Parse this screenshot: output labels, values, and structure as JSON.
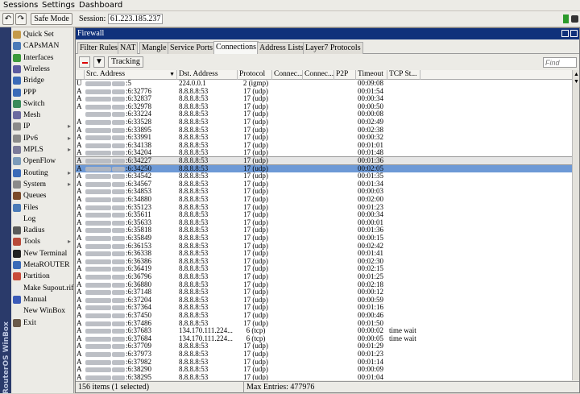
{
  "menu": {
    "sessions": "Sessions",
    "settings": "Settings",
    "dashboard": "Dashboard"
  },
  "toolbar": {
    "safe_mode": "Safe Mode",
    "session_label": "Session:",
    "session_value": "61.223.185.237"
  },
  "vertical_brand": "RouterOS WinBox",
  "sidebar": {
    "items": [
      {
        "label": "Quick Set",
        "icon": "quick-set-icon",
        "color": "#c49a4a",
        "submenu": false
      },
      {
        "label": "CAPsMAN",
        "icon": "capsman-icon",
        "color": "#4a7ab8",
        "submenu": false
      },
      {
        "label": "Interfaces",
        "icon": "interfaces-icon",
        "color": "#3c9a3c",
        "submenu": false
      },
      {
        "label": "Wireless",
        "icon": "wireless-icon",
        "color": "#5a5aa0",
        "submenu": false
      },
      {
        "label": "Bridge",
        "icon": "bridge-icon",
        "color": "#3a6ab8",
        "submenu": false
      },
      {
        "label": "PPP",
        "icon": "ppp-icon",
        "color": "#3a6ab8",
        "submenu": false
      },
      {
        "label": "Switch",
        "icon": "switch-icon",
        "color": "#3a8a5a",
        "submenu": false
      },
      {
        "label": "Mesh",
        "icon": "mesh-icon",
        "color": "#6a6aa0",
        "submenu": false
      },
      {
        "label": "IP",
        "icon": "ip-icon",
        "color": "#8a8a8a",
        "submenu": true
      },
      {
        "label": "IPv6",
        "icon": "ipv6-icon",
        "color": "#8a8a8a",
        "submenu": true
      },
      {
        "label": "MPLS",
        "icon": "mpls-icon",
        "color": "#7a7a9a",
        "submenu": true
      },
      {
        "label": "OpenFlow",
        "icon": "openflow-icon",
        "color": "#7a9aba",
        "submenu": false
      },
      {
        "label": "Routing",
        "icon": "routing-icon",
        "color": "#3a6ab8",
        "submenu": true
      },
      {
        "label": "System",
        "icon": "system-icon",
        "color": "#8a8a8a",
        "submenu": true
      },
      {
        "label": "Queues",
        "icon": "queues-icon",
        "color": "#7a4a2a",
        "submenu": false
      },
      {
        "label": "Files",
        "icon": "files-icon",
        "color": "#4a7ab8",
        "submenu": false
      },
      {
        "label": "Log",
        "icon": "log-icon",
        "color": "#eaeaea",
        "submenu": false
      },
      {
        "label": "Radius",
        "icon": "radius-icon",
        "color": "#5a5a5a",
        "submenu": false
      },
      {
        "label": "Tools",
        "icon": "tools-icon",
        "color": "#b84a3a",
        "submenu": true
      },
      {
        "label": "New Terminal",
        "icon": "terminal-icon",
        "color": "#222222",
        "submenu": false
      },
      {
        "label": "MetaROUTER",
        "icon": "metarouter-icon",
        "color": "#3a6ab8",
        "submenu": false
      },
      {
        "label": "Partition",
        "icon": "partition-icon",
        "color": "#c84a3a",
        "submenu": false
      },
      {
        "label": "Make Supout.rif",
        "icon": "supout-icon",
        "color": "#eaeaea",
        "submenu": false
      },
      {
        "label": "Manual",
        "icon": "manual-icon",
        "color": "#3a5ab8",
        "submenu": false
      },
      {
        "label": "New WinBox",
        "icon": "winbox-icon",
        "color": "#ecebe6",
        "submenu": false
      },
      {
        "label": "Exit",
        "icon": "exit-icon",
        "color": "#6a5a4a",
        "submenu": false
      }
    ]
  },
  "window": {
    "title": "Firewall",
    "tabs": [
      "Filter Rules",
      "NAT",
      "Mangle",
      "Service Ports",
      "Connections",
      "Address Lists",
      "Layer7 Protocols"
    ],
    "tracking_label": "Tracking",
    "find_placeholder": "Find",
    "columns": [
      "",
      "Src. Address",
      "Dst. Address",
      "Protocol",
      "Connec...",
      "Connec...",
      "P2P",
      "Timeout",
      "TCP St..."
    ],
    "rows": [
      {
        "flag": "U",
        "src": ":5",
        "dst": "224.0.0.1",
        "proto": "2 (igmp)",
        "timeout": "00:09:08",
        "tcp": ""
      },
      {
        "flag": "A",
        "src": ":6:32776",
        "dst": "8.8.8.8:53",
        "proto": "17 (udp)",
        "timeout": "00:01:54",
        "tcp": ""
      },
      {
        "flag": "A",
        "src": ":6:32837",
        "dst": "8.8.8.8:53",
        "proto": "17 (udp)",
        "timeout": "00:00:34",
        "tcp": ""
      },
      {
        "flag": "A",
        "src": ":6:32978",
        "dst": "8.8.8.8:53",
        "proto": "17 (udp)",
        "timeout": "00:00:50",
        "tcp": ""
      },
      {
        "flag": "",
        "src": ":6:33224",
        "dst": "8.8.8.8:53",
        "proto": "17 (udp)",
        "timeout": "00:00:08",
        "tcp": ""
      },
      {
        "flag": "A",
        "src": ":6:33528",
        "dst": "8.8.8.8:53",
        "proto": "17 (udp)",
        "timeout": "00:02:49",
        "tcp": ""
      },
      {
        "flag": "A",
        "src": ":6:33895",
        "dst": "8.8.8.8:53",
        "proto": "17 (udp)",
        "timeout": "00:02:38",
        "tcp": ""
      },
      {
        "flag": "A",
        "src": ":6:33991",
        "dst": "8.8.8.8:53",
        "proto": "17 (udp)",
        "timeout": "00:00:32",
        "tcp": ""
      },
      {
        "flag": "A",
        "src": ":6:34138",
        "dst": "8.8.8.8:53",
        "proto": "17 (udp)",
        "timeout": "00:01:01",
        "tcp": ""
      },
      {
        "flag": "A",
        "src": ":6:34204",
        "dst": "8.8.8.8:53",
        "proto": "17 (udp)",
        "timeout": "00:01:48",
        "tcp": ""
      },
      {
        "flag": "A",
        "src": ":6:34227",
        "dst": "8.8.8.8:53",
        "proto": "17 (udp)",
        "timeout": "00:01:36",
        "tcp": ""
      },
      {
        "flag": "A",
        "src": ":6:34250",
        "dst": "8.8.8.8:53",
        "proto": "17 (udp)",
        "timeout": "00:02:05",
        "tcp": ""
      },
      {
        "flag": "A",
        "src": ":6:34542",
        "dst": "8.8.8.8:53",
        "proto": "17 (udp)",
        "timeout": "00:01:35",
        "tcp": ""
      },
      {
        "flag": "A",
        "src": ":6:34567",
        "dst": "8.8.8.8:53",
        "proto": "17 (udp)",
        "timeout": "00:01:34",
        "tcp": ""
      },
      {
        "flag": "A",
        "src": ":6:34853",
        "dst": "8.8.8.8:53",
        "proto": "17 (udp)",
        "timeout": "00:00:03",
        "tcp": ""
      },
      {
        "flag": "A",
        "src": ":6:34880",
        "dst": "8.8.8.8:53",
        "proto": "17 (udp)",
        "timeout": "00:02:00",
        "tcp": ""
      },
      {
        "flag": "A",
        "src": ":6:35123",
        "dst": "8.8.8.8:53",
        "proto": "17 (udp)",
        "timeout": "00:01:23",
        "tcp": ""
      },
      {
        "flag": "A",
        "src": ":6:35611",
        "dst": "8.8.8.8:53",
        "proto": "17 (udp)",
        "timeout": "00:00:34",
        "tcp": ""
      },
      {
        "flag": "A",
        "src": ":6:35633",
        "dst": "8.8.8.8:53",
        "proto": "17 (udp)",
        "timeout": "00:00:01",
        "tcp": ""
      },
      {
        "flag": "A",
        "src": ":6:35818",
        "dst": "8.8.8.8:53",
        "proto": "17 (udp)",
        "timeout": "00:01:36",
        "tcp": ""
      },
      {
        "flag": "A",
        "src": ":6:35849",
        "dst": "8.8.8.8:53",
        "proto": "17 (udp)",
        "timeout": "00:00:15",
        "tcp": ""
      },
      {
        "flag": "A",
        "src": ":6:36153",
        "dst": "8.8.8.8:53",
        "proto": "17 (udp)",
        "timeout": "00:02:42",
        "tcp": ""
      },
      {
        "flag": "A",
        "src": ":6:36338",
        "dst": "8.8.8.8:53",
        "proto": "17 (udp)",
        "timeout": "00:01:41",
        "tcp": ""
      },
      {
        "flag": "A",
        "src": ":6:36386",
        "dst": "8.8.8.8:53",
        "proto": "17 (udp)",
        "timeout": "00:02:30",
        "tcp": ""
      },
      {
        "flag": "A",
        "src": ":6:36419",
        "dst": "8.8.8.8:53",
        "proto": "17 (udp)",
        "timeout": "00:02:15",
        "tcp": ""
      },
      {
        "flag": "A",
        "src": ":6:36796",
        "dst": "8.8.8.8:53",
        "proto": "17 (udp)",
        "timeout": "00:01:25",
        "tcp": ""
      },
      {
        "flag": "A",
        "src": ":6:36880",
        "dst": "8.8.8.8:53",
        "proto": "17 (udp)",
        "timeout": "00:02:18",
        "tcp": ""
      },
      {
        "flag": "A",
        "src": ":6:37148",
        "dst": "8.8.8.8:53",
        "proto": "17 (udp)",
        "timeout": "00:00:12",
        "tcp": ""
      },
      {
        "flag": "A",
        "src": ":6:37204",
        "dst": "8.8.8.8:53",
        "proto": "17 (udp)",
        "timeout": "00:00:59",
        "tcp": ""
      },
      {
        "flag": "A",
        "src": ":6:37364",
        "dst": "8.8.8.8:53",
        "proto": "17 (udp)",
        "timeout": "00:01:16",
        "tcp": ""
      },
      {
        "flag": "A",
        "src": ":6:37450",
        "dst": "8.8.8.8:53",
        "proto": "17 (udp)",
        "timeout": "00:00:46",
        "tcp": ""
      },
      {
        "flag": "A",
        "src": ":6:37486",
        "dst": "8.8.8.8:53",
        "proto": "17 (udp)",
        "timeout": "00:01:50",
        "tcp": ""
      },
      {
        "flag": "A",
        "src": ":6:37683",
        "dst": "134.170.111.224...",
        "proto": "6 (tcp)",
        "timeout": "00:00:02",
        "tcp": "time wait"
      },
      {
        "flag": "A",
        "src": ":6:37684",
        "dst": "134.170.111.224...",
        "proto": "6 (tcp)",
        "timeout": "00:00:05",
        "tcp": "time wait"
      },
      {
        "flag": "A",
        "src": ":6:37709",
        "dst": "8.8.8.8:53",
        "proto": "17 (udp)",
        "timeout": "00:01:29",
        "tcp": ""
      },
      {
        "flag": "A",
        "src": ":6:37973",
        "dst": "8.8.8.8:53",
        "proto": "17 (udp)",
        "timeout": "00:01:23",
        "tcp": ""
      },
      {
        "flag": "A",
        "src": ":6:37982",
        "dst": "8.8.8.8:53",
        "proto": "17 (udp)",
        "timeout": "00:01:14",
        "tcp": ""
      },
      {
        "flag": "A",
        "src": ":6:38290",
        "dst": "8.8.8.8:53",
        "proto": "17 (udp)",
        "timeout": "00:00:09",
        "tcp": ""
      },
      {
        "flag": "A",
        "src": ":6:38295",
        "dst": "8.8.8.8:53",
        "proto": "17 (udp)",
        "timeout": "00:01:04",
        "tcp": ""
      }
    ],
    "selected_row": 11,
    "highlighted_row": 10,
    "status_left": "156 items (1 selected)",
    "status_right": "Max Entries: 477976"
  }
}
